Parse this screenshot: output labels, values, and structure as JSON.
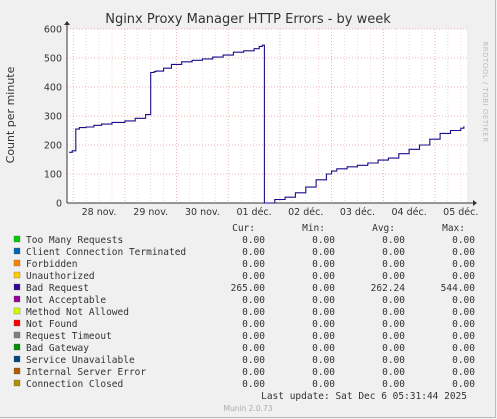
{
  "chart_data": {
    "type": "line",
    "title": "Nginx Proxy Manager HTTP Errors - by week",
    "ylabel": "Count per minute",
    "side_label": "RRDTOOL / TOBI OETIKER",
    "ylim": [
      0,
      600
    ],
    "y_ticks": [
      "0",
      "100",
      "200",
      "300",
      "400",
      "500",
      "600"
    ],
    "x_ticks": [
      "28 nov.",
      "29 nov.",
      "30 nov.",
      "01 déc.",
      "02 déc.",
      "03 déc.",
      "04 déc.",
      "05 déc."
    ],
    "grid": true,
    "series": [
      {
        "name": "Bad Request",
        "color": "#1a0c8c",
        "x": [
          -0.08,
          -0.02,
          0.05,
          0.12,
          0.25,
          0.4,
          0.55,
          0.75,
          1.0,
          1.2,
          1.4,
          1.5,
          1.56,
          1.58,
          1.6,
          1.75,
          1.9,
          2.1,
          2.3,
          2.5,
          2.7,
          2.9,
          3.1,
          3.3,
          3.5,
          3.6,
          3.66,
          3.68,
          3.7,
          3.75,
          3.9,
          4.1,
          4.3,
          4.5,
          4.7,
          4.9,
          5.0,
          5.1,
          5.3,
          5.5,
          5.7,
          5.9,
          6.1,
          6.3,
          6.5,
          6.7,
          6.9,
          7.1,
          7.3,
          7.5,
          7.56
        ],
        "values": [
          175,
          180,
          255,
          260,
          262,
          268,
          272,
          278,
          283,
          292,
          305,
          450,
          452,
          453,
          455,
          465,
          478,
          487,
          492,
          497,
          503,
          510,
          520,
          525,
          532,
          540,
          544,
          544,
          0,
          0,
          12,
          20,
          35,
          55,
          80,
          100,
          110,
          118,
          125,
          130,
          138,
          148,
          155,
          170,
          185,
          200,
          220,
          240,
          250,
          258,
          265
        ]
      }
    ],
    "legend_headers": [
      "Cur:",
      "Min:",
      "Avg:",
      "Max:"
    ],
    "legend": [
      {
        "name": "Too Many Requests",
        "color": "#00cc00",
        "cur": "0.00",
        "min": "0.00",
        "avg": "0.00",
        "max": "0.00"
      },
      {
        "name": "Client Connection Terminated",
        "color": "#0066b3",
        "cur": "0.00",
        "min": "0.00",
        "avg": "0.00",
        "max": "0.00"
      },
      {
        "name": "Forbidden",
        "color": "#ff8000",
        "cur": "0.00",
        "min": "0.00",
        "avg": "0.00",
        "max": "0.00"
      },
      {
        "name": "Unauthorized",
        "color": "#ffcc00",
        "cur": "0.00",
        "min": "0.00",
        "avg": "0.00",
        "max": "0.00"
      },
      {
        "name": "Bad Request",
        "color": "#330099",
        "cur": "265.00",
        "min": "0.00",
        "avg": "262.24",
        "max": "544.00"
      },
      {
        "name": "Not Acceptable",
        "color": "#990099",
        "cur": "0.00",
        "min": "0.00",
        "avg": "0.00",
        "max": "0.00"
      },
      {
        "name": "Method Not Allowed",
        "color": "#ccff00",
        "cur": "0.00",
        "min": "0.00",
        "avg": "0.00",
        "max": "0.00"
      },
      {
        "name": "Not Found",
        "color": "#ff0000",
        "cur": "0.00",
        "min": "0.00",
        "avg": "0.00",
        "max": "0.00"
      },
      {
        "name": "Request Timeout",
        "color": "#808080",
        "cur": "0.00",
        "min": "0.00",
        "avg": "0.00",
        "max": "0.00"
      },
      {
        "name": "Bad Gateway",
        "color": "#008f00",
        "cur": "0.00",
        "min": "0.00",
        "avg": "0.00",
        "max": "0.00"
      },
      {
        "name": "Service Unavailable",
        "color": "#00487d",
        "cur": "0.00",
        "min": "0.00",
        "avg": "0.00",
        "max": "0.00"
      },
      {
        "name": "Internal Server Error",
        "color": "#b35a00",
        "cur": "0.00",
        "min": "0.00",
        "avg": "0.00",
        "max": "0.00"
      },
      {
        "name": "Connection Closed",
        "color": "#b38f00",
        "cur": "0.00",
        "min": "0.00",
        "avg": "0.00",
        "max": "0.00"
      }
    ],
    "last_update": "Last update: Sat Dec  6 05:31:44 2025",
    "footer": "Munin 2.0.73"
  }
}
